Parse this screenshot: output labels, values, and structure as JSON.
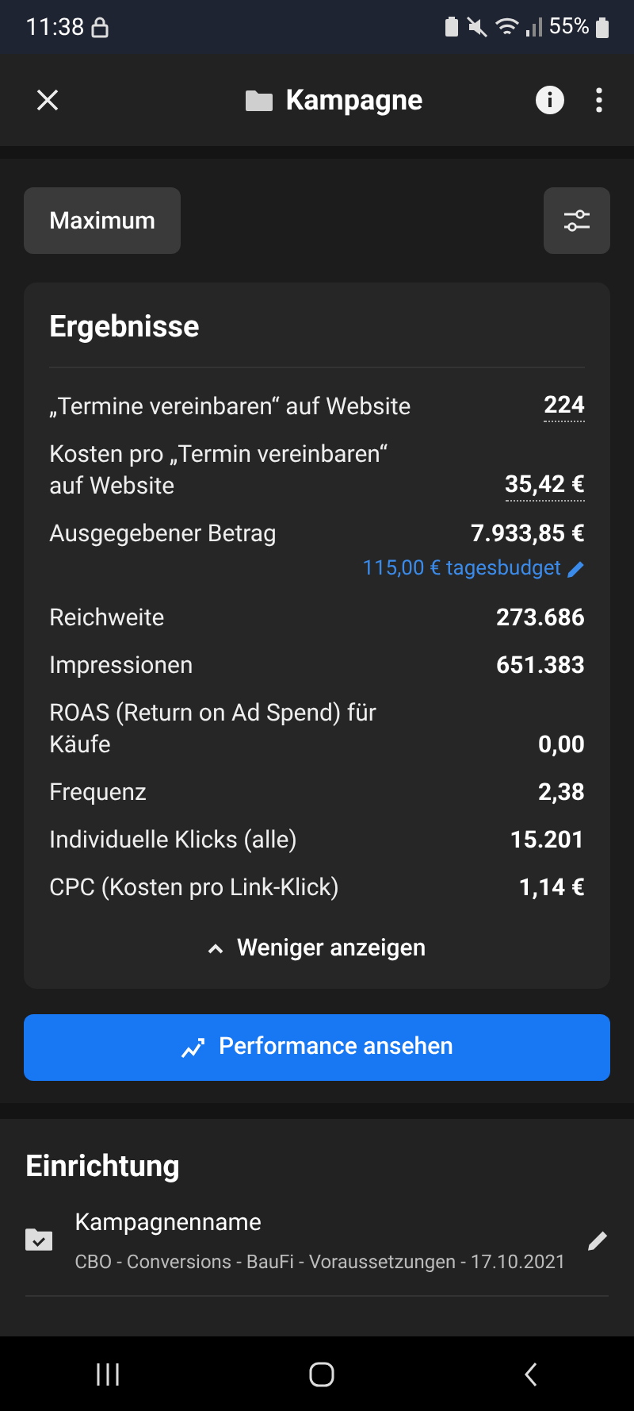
{
  "status_bar": {
    "time": "11:38",
    "battery": "55%"
  },
  "app_bar": {
    "title": "Kampagne"
  },
  "filter": {
    "label": "Maximum"
  },
  "results": {
    "title": "Ergebnisse",
    "rows": [
      {
        "label": "„Termine vereinbaren“ auf Website",
        "value": "224",
        "underlined": true
      },
      {
        "label": "Kosten pro „Termin vereinbaren“ auf Website",
        "value": "35,42 €",
        "underlined": true
      },
      {
        "label": "Ausgegebener Betrag",
        "value": "7.933,85 €",
        "underlined": false,
        "budget": "115,00 € tagesbudget"
      },
      {
        "label": "Reichweite",
        "value": "273.686",
        "underlined": false
      },
      {
        "label": "Impressionen",
        "value": "651.383",
        "underlined": false
      },
      {
        "label": "ROAS (Return on Ad Spend) für Käufe",
        "value": "0,00",
        "underlined": false
      },
      {
        "label": "Frequenz",
        "value": "2,38",
        "underlined": false
      },
      {
        "label": "Individuelle Klicks (alle)",
        "value": "15.201",
        "underlined": false
      },
      {
        "label": "CPC (Kosten pro Link-Klick)",
        "value": "1,14 €",
        "underlined": false
      }
    ],
    "toggle": "Weniger anzeigen"
  },
  "performance_button": "Performance ansehen",
  "setup": {
    "title": "Einrichtung",
    "items": [
      {
        "label": "Kampagnenname",
        "value": "CBO - Conversions - BauFi - Voraussetzungen - 17.10.2021"
      }
    ]
  }
}
